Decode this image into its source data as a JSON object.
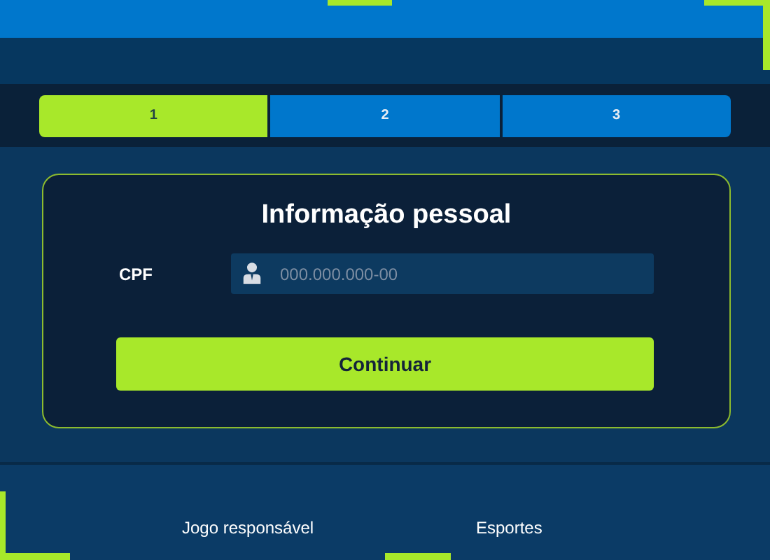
{
  "steps": [
    {
      "label": "1",
      "selected": true
    },
    {
      "label": "2",
      "selected": false
    },
    {
      "label": "3",
      "selected": false
    }
  ],
  "form": {
    "title": "Informação pessoal",
    "field": {
      "label": "CPF",
      "placeholder": "000.000.000-00"
    },
    "button": "Continuar"
  },
  "footer": {
    "columns": [
      [
        "Jogo responsável"
      ],
      [
        "Esportes"
      ]
    ]
  }
}
